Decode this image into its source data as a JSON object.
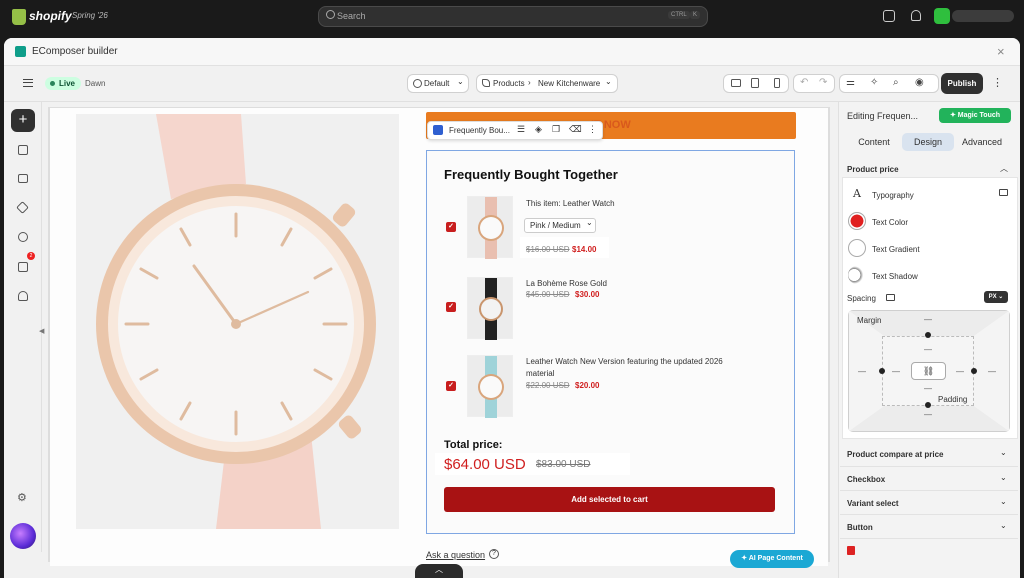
{
  "shopify": {
    "brand": "shopify",
    "edition": "Spring '26",
    "search_placeholder": "Search",
    "shortcut_ctrl": "CTRL",
    "shortcut_k": "K"
  },
  "window": {
    "title": "EComposer builder",
    "close": "×"
  },
  "toolbar": {
    "live": "Live",
    "theme": "Dawn",
    "device": "Default",
    "page_type": "Products",
    "page_arrow": "›",
    "page_name": "New Kitchenware",
    "publish": "Publish",
    "more": "⋮",
    "chevron": "⌄"
  },
  "canvas": {
    "banner_text": "IT NOW",
    "block_name": "Frequently Bou...",
    "fbt_title": "Frequently Bought Together",
    "items": [
      {
        "title": "This item:  Leather Watch",
        "variant": "Pink / Medium",
        "old_price": "$16.00 USD",
        "new_price": "$14.00"
      },
      {
        "title": "La Bohème Rose Gold",
        "old_price": "$45.00 USD",
        "new_price": "$30.00"
      },
      {
        "title": "Leather Watch New Version featuring the updated 2026",
        "title_line2": "material",
        "old_price": "$22.00 USD",
        "new_price": "$20.00"
      }
    ],
    "check": "✓",
    "total_label": "Total price:",
    "total_price": "$64.00 USD",
    "total_old": "$83.00 USD",
    "add_to_cart": "Add selected to cart",
    "ask_question": "Ask a question",
    "ask_icon": "?",
    "ai_button": "✦ AI Page Content",
    "bottom_tab": "︿"
  },
  "rail": {
    "add": "+",
    "badge": "2",
    "gear": "⚙",
    "collapse": "◀"
  },
  "panel": {
    "title": "Editing Frequen...",
    "magic_touch": "✦ Magic Touch",
    "tabs": [
      "Content",
      "Design",
      "Advanced"
    ],
    "section_product_price": "Product price",
    "typography": "Typography",
    "typography_icon": "A",
    "text_color": "Text Color",
    "text_gradient": "Text Gradient",
    "text_shadow": "Text Shadow",
    "spacing": "Spacing",
    "unit": "PX ⌄",
    "margin": "Margin",
    "padding": "Padding",
    "link_icon": "⛓",
    "dash": "—",
    "sections": [
      "Product compare at price",
      "Checkbox",
      "Variant select",
      "Button"
    ],
    "chev_up": "︿",
    "chev_down": "⌄"
  },
  "colors": {
    "accent_red": "#c81e1e",
    "brand_green": "#22b35b",
    "orange": "#e97b1f",
    "ai_blue": "#1ba8d4"
  }
}
